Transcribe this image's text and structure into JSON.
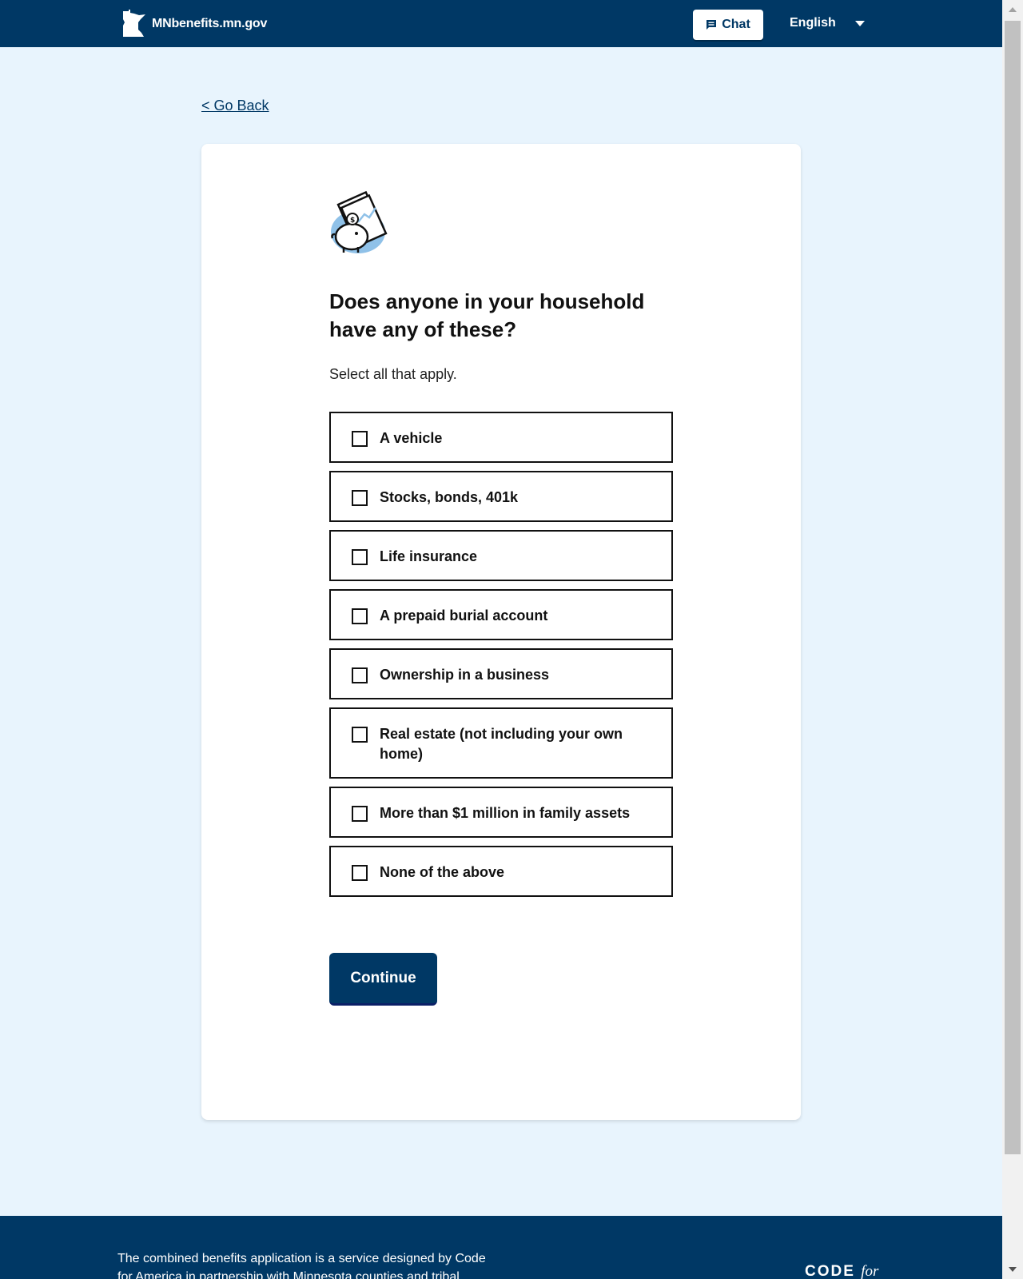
{
  "header": {
    "site_name": "MNbenefits.mn.gov",
    "chat_label": "Chat",
    "language": "English",
    "colors": {
      "header_bg": "#003865",
      "page_bg": "#e8f4fd"
    }
  },
  "nav": {
    "go_back": "< Go Back"
  },
  "main": {
    "question": "Does anyone in your household have any of these?",
    "helper": "Select all that apply.",
    "options": [
      {
        "label": "A vehicle",
        "checked": false
      },
      {
        "label": "Stocks, bonds, 401k",
        "checked": false
      },
      {
        "label": "Life insurance",
        "checked": false
      },
      {
        "label": "A prepaid burial account",
        "checked": false
      },
      {
        "label": "Ownership in a business",
        "checked": false
      },
      {
        "label": "Real estate (not including your own home)",
        "checked": false
      },
      {
        "label": "More than $1 million in family assets",
        "checked": false
      },
      {
        "label": "None of the above",
        "checked": false
      }
    ],
    "continue_label": "Continue"
  },
  "footer": {
    "text": "The combined benefits application is a service designed by Code for America in partnership with Minnesota counties and tribal",
    "logo_code": "CODE",
    "logo_for": "for"
  }
}
